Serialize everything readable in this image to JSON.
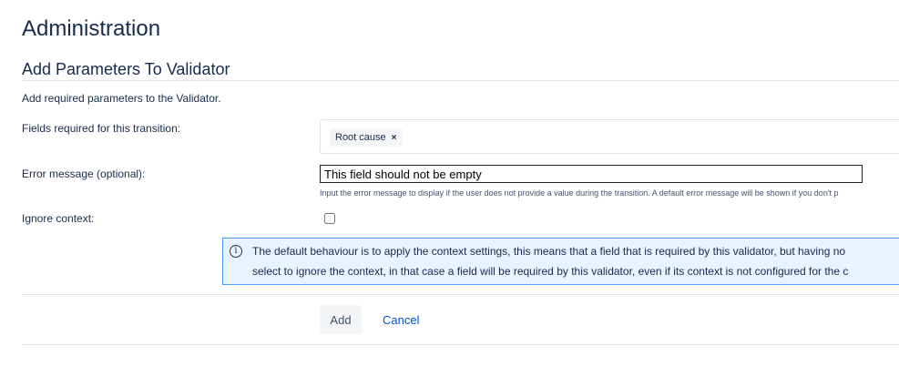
{
  "page_title": "Administration",
  "section_title": "Add Parameters To Validator",
  "description": "Add required parameters to the Validator.",
  "fields": {
    "required_fields_label": "Fields required for this transition:",
    "required_fields_chips": [
      "Root cause"
    ],
    "chip_remove_glyph": "×",
    "error_message_label": "Error message (optional):",
    "error_message_value": "This field should not be empty",
    "error_message_help": "Input the error message to display if the user does not provide a value during the transition. A default error message will be shown if you don't p",
    "ignore_context_label": "Ignore context:",
    "ignore_context_checked": false
  },
  "info": {
    "line1": "The default behaviour is to apply the context settings, this means that a field that is required by this validator, but having no",
    "line2": "select to ignore the context, in that case a field will be required by this validator, even if its context is not configured for the c"
  },
  "actions": {
    "add_label": "Add",
    "cancel_label": "Cancel"
  },
  "colors": {
    "link": "#0052cc",
    "info_bg": "#e9f2ff",
    "info_border": "#4c9aff"
  }
}
